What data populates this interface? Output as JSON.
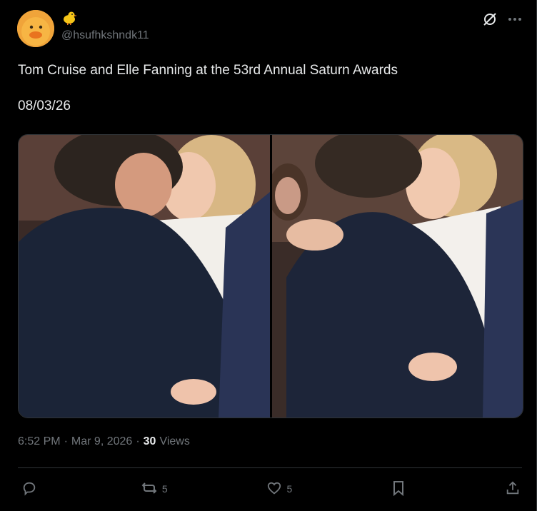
{
  "author": {
    "display_name_icon": "chick-emoji-icon",
    "handle": "@hsufhkshndk11"
  },
  "tweet": {
    "text": "Tom Cruise and Elle Fanning at the 53rd Annual Saturn Awards\n\n08/03/26"
  },
  "meta": {
    "time": "6:52 PM",
    "separator1": "·",
    "date": "Mar 9, 2026",
    "separator2": "·",
    "views_count": "30",
    "views_label": "Views"
  },
  "actions": {
    "reply_count": "",
    "repost_count": "5",
    "like_count": "5"
  },
  "colors": {
    "background": "#000000",
    "text": "#e7e9ea",
    "muted": "#71767b",
    "divider": "#2f3336"
  }
}
